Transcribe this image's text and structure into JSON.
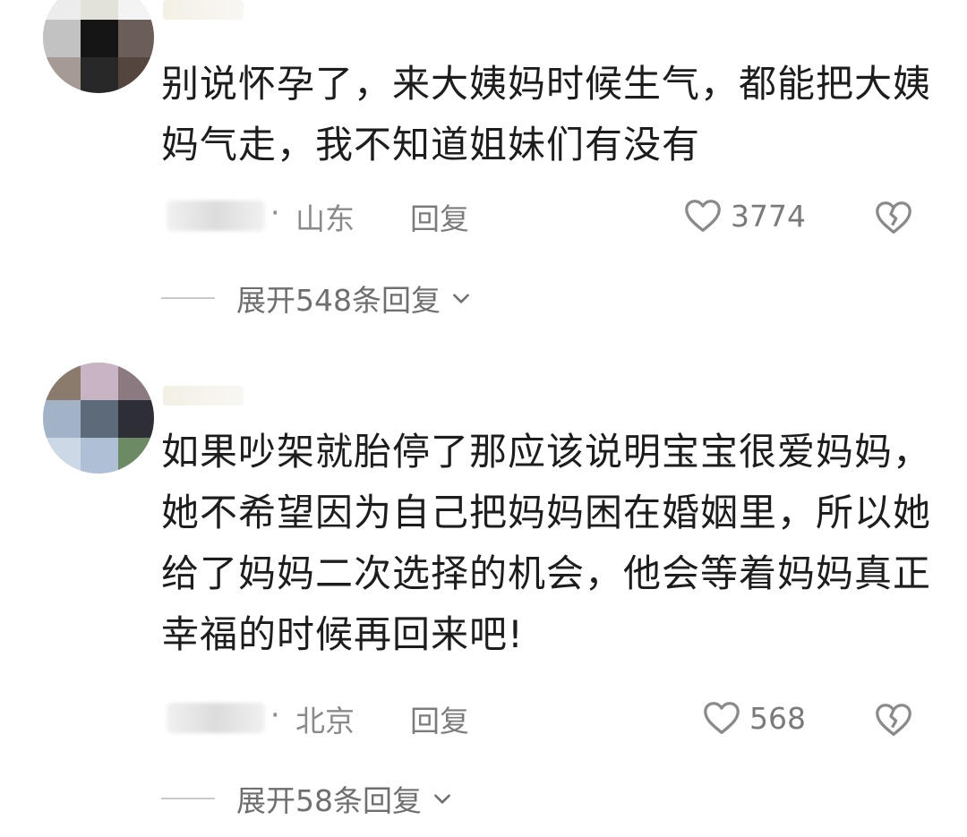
{
  "comments": [
    {
      "text": "别说怀孕了，来大姨妈时候生气，都能把大姨妈气走，我不知道姐妹们有没有",
      "meta": {
        "dot": "·",
        "location": "山东",
        "reply": "回复",
        "likes": "3774"
      },
      "expand": "展开548条回复"
    },
    {
      "text": "如果吵架就胎停了那应该说明宝宝很爱妈妈，她不希望因为自己把妈妈困在婚姻里，所以她给了妈妈二次选择的机会，他会等着妈妈真正幸福的时候再回来吧!",
      "meta": {
        "dot": "·",
        "location": "北京",
        "reply": "回复",
        "likes": "568"
      },
      "expand": "展开58条回复"
    }
  ],
  "icons": {
    "like": "heart-outline-icon",
    "dislike": "broken-heart-icon",
    "expand": "chevron-down-icon"
  },
  "colors": {
    "text": "#1d1d1d",
    "meta": "#8a8a8a",
    "divider": "#c9c9c9"
  }
}
